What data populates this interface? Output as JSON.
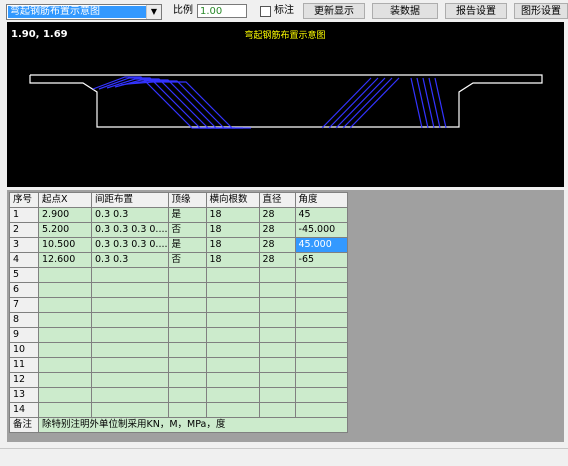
{
  "toolbar": {
    "view_select": "弯起钢筋布置示意图",
    "scale_label": "比例",
    "scale_value": "1.00",
    "label_checkbox": "标注",
    "buttons": [
      "更新显示",
      "装数据",
      "报告设置",
      "图形设置"
    ]
  },
  "canvas": {
    "coords": "1.90, 1.69",
    "title": "弯起钢筋布置示意图",
    "background": "#000000",
    "outline_color": "#ffffff",
    "rebar_color": "#3333ff",
    "title_color": "#ffff00"
  },
  "grid": {
    "headers": [
      "序号",
      "起点X",
      "间距布置",
      "顶缘",
      "横向根数",
      "直径",
      "角度"
    ],
    "rows": [
      [
        "1",
        "2.900",
        "0.3 0.3",
        "是",
        "18",
        "28",
        "45"
      ],
      [
        "2",
        "5.200",
        "0.3 0.3 0.3 0....",
        "否",
        "18",
        "28",
        "-45.000"
      ],
      [
        "3",
        "10.500",
        "0.3 0.3 0.3 0....",
        "是",
        "18",
        "28",
        "45.000"
      ],
      [
        "4",
        "12.600",
        "0.3 0.3",
        "否",
        "18",
        "28",
        "-65"
      ],
      [
        "5",
        "",
        "",
        "",
        "",
        "",
        ""
      ],
      [
        "6",
        "",
        "",
        "",
        "",
        "",
        ""
      ],
      [
        "7",
        "",
        "",
        "",
        "",
        "",
        ""
      ],
      [
        "8",
        "",
        "",
        "",
        "",
        "",
        ""
      ],
      [
        "9",
        "",
        "",
        "",
        "",
        "",
        ""
      ],
      [
        "10",
        "",
        "",
        "",
        "",
        "",
        ""
      ],
      [
        "11",
        "",
        "",
        "",
        "",
        "",
        ""
      ],
      [
        "12",
        "",
        "",
        "",
        "",
        "",
        ""
      ],
      [
        "13",
        "",
        "",
        "",
        "",
        "",
        ""
      ],
      [
        "14",
        "",
        "",
        "",
        "",
        "",
        ""
      ]
    ],
    "selected_row": 3,
    "note_label": "备注",
    "note_text": "除特别注明外单位制采用KN，M，MPa，度",
    "cell_color": "#ccebcc",
    "selected_color": "#3399ff"
  }
}
